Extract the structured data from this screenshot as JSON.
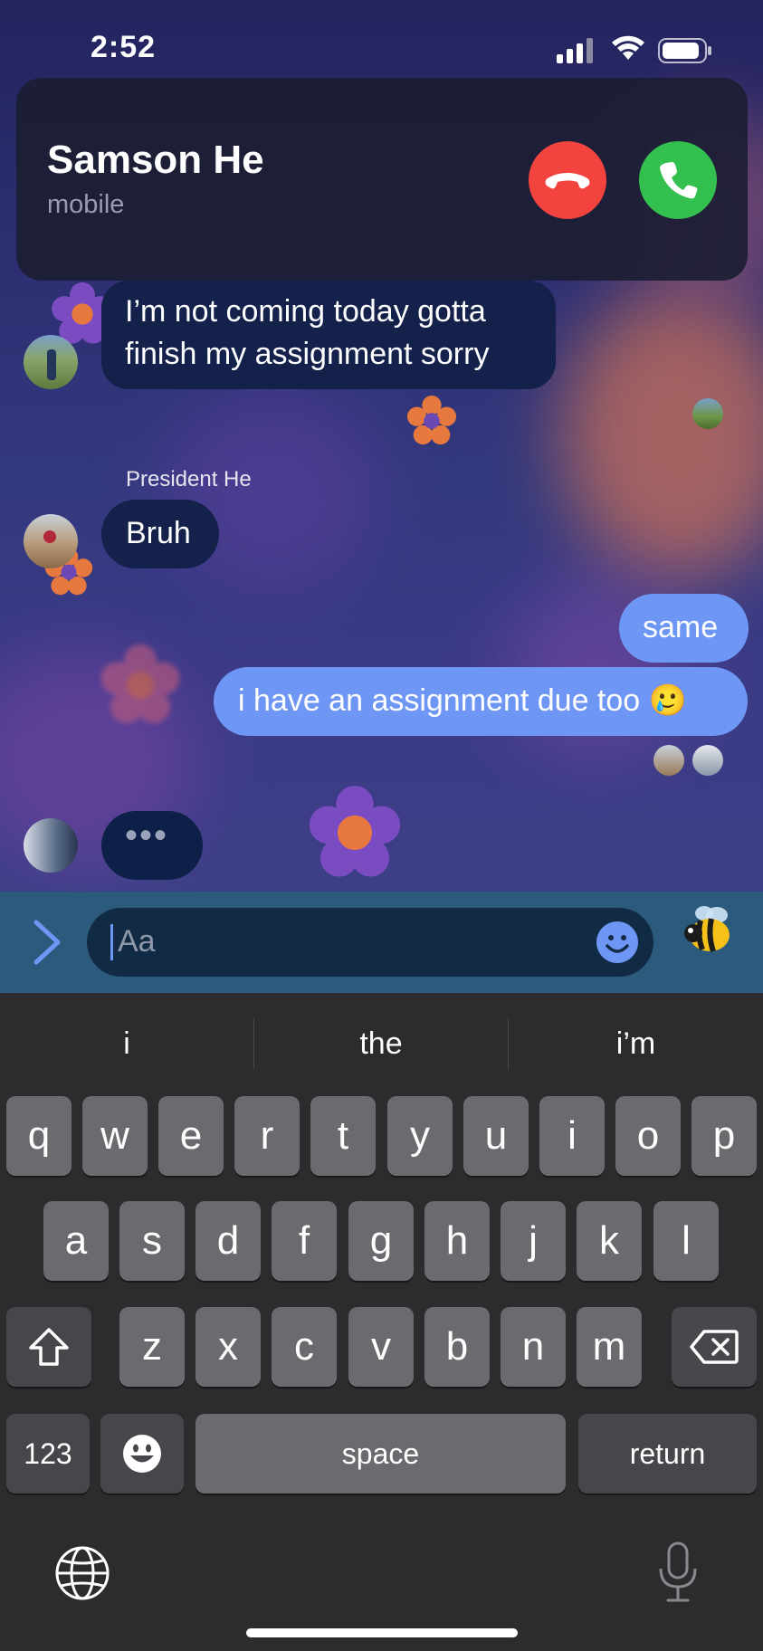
{
  "status_bar": {
    "time": "2:52"
  },
  "incoming_call": {
    "caller_name": "Samson He",
    "caller_type": "mobile"
  },
  "messages": [
    {
      "direction": "incoming",
      "sender": "",
      "lines": [
        "I’m not coming today gotta",
        "finish my assignment sorry"
      ]
    },
    {
      "direction": "incoming",
      "sender": "President He",
      "lines": [
        "Bruh"
      ]
    },
    {
      "direction": "outgoing",
      "lines": [
        "same"
      ]
    },
    {
      "direction": "outgoing",
      "lines": [
        "i have an assignment due too 🥲"
      ]
    }
  ],
  "typing_indicator": {
    "dots": "•••"
  },
  "composer": {
    "placeholder": "Aa"
  },
  "keyboard": {
    "suggestions": [
      "i",
      "the",
      "i’m"
    ],
    "row1": [
      "q",
      "w",
      "e",
      "r",
      "t",
      "y",
      "u",
      "i",
      "o",
      "p"
    ],
    "row2": [
      "a",
      "s",
      "d",
      "f",
      "g",
      "h",
      "j",
      "k",
      "l"
    ],
    "row3": [
      "z",
      "x",
      "c",
      "v",
      "b",
      "n",
      "m"
    ],
    "numbers_key": "123",
    "space_key": "space",
    "return_key": "return"
  },
  "colors": {
    "outgoing_bubble": "#6e96f5",
    "incoming_bubble": "#13214b",
    "decline": "#f2433e",
    "accept": "#33c04f",
    "composer_bar": "#2b5a7c"
  }
}
